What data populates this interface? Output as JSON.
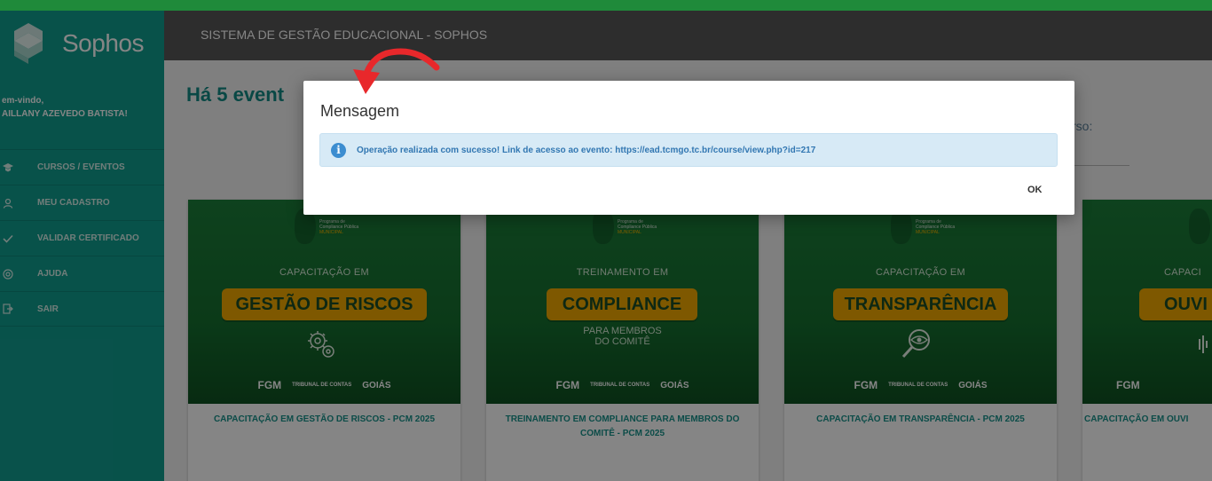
{
  "sidebar": {
    "logo_text": "Sophos",
    "welcome_line1": "em-vindo,",
    "welcome_line2": "AILLANY AZEVEDO BATISTA!",
    "items": [
      {
        "label": "CURSOS / EVENTOS",
        "icon": "graduation-icon"
      },
      {
        "label": "MEU CADASTRO",
        "icon": "user-icon"
      },
      {
        "label": "VALIDAR CERTIFICADO",
        "icon": "check-icon"
      },
      {
        "label": "AJUDA",
        "icon": "help-icon"
      },
      {
        "label": "SAIR",
        "icon": "exit-icon"
      }
    ]
  },
  "topbar": {
    "title": "SISTEMA DE GESTÃO EDUCACIONAL - SOPHOS"
  },
  "main": {
    "heading": "Há 5 event",
    "search_label": "rso:",
    "cards": [
      {
        "banner_prefix": "CAPACITAÇÃO EM",
        "banner_main": "GESTÃO DE RISCOS",
        "banner_extra": "",
        "title": "CAPACITAÇÃO EM GESTÃO DE RISCOS - PCM 2025"
      },
      {
        "banner_prefix": "TREINAMENTO EM",
        "banner_main": "COMPLIANCE",
        "banner_extra": "PARA MEMBROS DO COMITÊ",
        "title": "TREINAMENTO EM COMPLIANCE PARA MEMBROS DO COMITÊ - PCM 2025"
      },
      {
        "banner_prefix": "CAPACITAÇÃO EM",
        "banner_main": "TRANSPARÊNCIA",
        "banner_extra": "",
        "title": "CAPACITAÇÃO EM TRANSPARÊNCIA - PCM 2025"
      },
      {
        "banner_prefix": "CAPACI",
        "banner_main": "OUVI",
        "banner_extra": "",
        "title": "CAPACITAÇÃO EM OUVI"
      }
    ],
    "banner_program": [
      "Programa de",
      "Compliance Pública",
      "MUNICIPAL"
    ],
    "banner_logos": [
      "FGM",
      "TRIBUNAL DE CONTAS",
      "GOIÁS"
    ]
  },
  "modal": {
    "title": "Mensagem",
    "message": "Operação realizada com sucesso! Link de acesso ao evento: https://ead.tcmgo.tc.br/course/view.php?id=217",
    "ok_label": "OK",
    "info_icon": "info-icon"
  },
  "colors": {
    "frame_border": "#1f8a3a",
    "sidebar": "#119e8f",
    "topbar": "#565656",
    "banner_pill": "#f2a900",
    "card_title": "#17928b",
    "annotation_arrow": "#e8282b"
  }
}
